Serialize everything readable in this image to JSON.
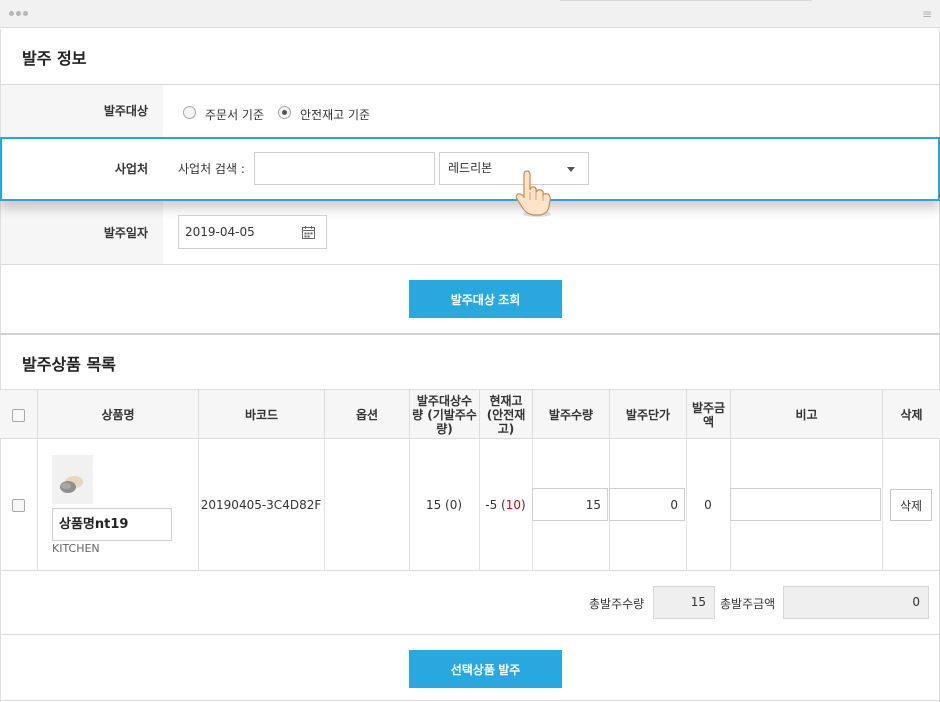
{
  "order_info": {
    "title": "발주 정보",
    "target_label": "발주대상",
    "target_options": [
      "주문서 기준",
      "안전재고 기준"
    ],
    "target_selected": "안전재고 기준",
    "vendor_label": "사업처",
    "vendor_search_label": "사업처 검색 :",
    "vendor_search_value": "",
    "vendor_select_value": "레드리본",
    "date_label": "발주일자",
    "date_value": "2019-04-05",
    "search_button": "발주대상 조회"
  },
  "product_list": {
    "title": "발주상품 목록",
    "headers": {
      "name": "상품명",
      "barcode": "바코드",
      "option": "옵션",
      "target_qty": "발주대상수량 (기발주수량)",
      "stock": "현재고 (안전재고)",
      "order_qty": "발주수량",
      "unit_price": "발주단가",
      "amount": "발주금액",
      "memo": "비고",
      "delete": "삭제"
    },
    "rows": [
      {
        "name": "상품명nt19",
        "category": "KITCHEN",
        "barcode": "20190405-3C4D82F",
        "option": "",
        "target_qty": "15 (0)",
        "stock_main": "-5 (",
        "stock_safety": "10",
        "stock_close": ")",
        "order_qty": "15",
        "unit_price": "0",
        "amount": "0",
        "memo": "",
        "delete_label": "삭제"
      }
    ],
    "total_qty_label": "총발주수량",
    "total_qty_value": "15",
    "total_amount_label": "총발주금액",
    "total_amount_value": "0",
    "submit_button": "선택상품 발주"
  },
  "colors": {
    "accent": "#29a8e0",
    "highlight_border": "#2aa4dc",
    "stock_safety": "#d0021b"
  },
  "icons": {
    "calendar": "calendar-icon",
    "pointer": "hand-pointer-icon",
    "dropdown": "chevron-down-icon"
  }
}
